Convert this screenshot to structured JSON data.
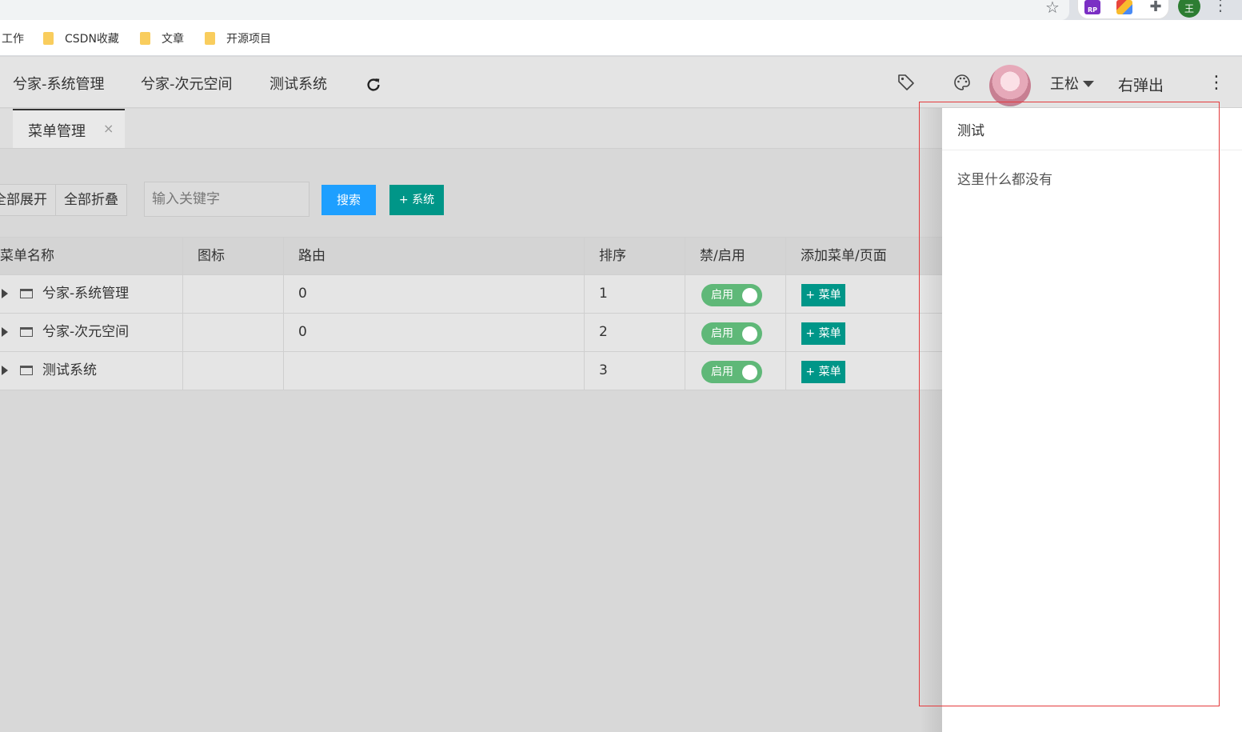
{
  "bookmarks": [
    {
      "label": "工作"
    },
    {
      "label": "CSDN收藏"
    },
    {
      "label": "文章"
    },
    {
      "label": "开源项目"
    }
  ],
  "browser": {
    "profile_initial": "王",
    "ext_rp_label": "RP"
  },
  "header": {
    "nav": [
      {
        "label": "兮家-系统管理"
      },
      {
        "label": "兮家-次元空间"
      },
      {
        "label": "测试系统"
      }
    ],
    "user_name": "王松",
    "right_popup_label": "右弹出"
  },
  "tabs": [
    {
      "label": "菜单管理",
      "close": "×"
    }
  ],
  "toolbar": {
    "expand_all": "全部展开",
    "collapse_all": "全部折叠",
    "search_placeholder": "输入关键字",
    "search_label": "搜索",
    "add_system_label": "+ 系统"
  },
  "table": {
    "columns": [
      "菜单名称",
      "图标",
      "路由",
      "排序",
      "禁/启用",
      "添加菜单/页面"
    ],
    "rows": [
      {
        "name": "兮家-系统管理",
        "icon": "",
        "route": "0",
        "order": "1",
        "status": "启用",
        "action": "+ 菜单"
      },
      {
        "name": "兮家-次元空间",
        "icon": "",
        "route": "0",
        "order": "2",
        "status": "启用",
        "action": "+ 菜单"
      },
      {
        "name": "测试系统",
        "icon": "",
        "route": "",
        "order": "3",
        "status": "启用",
        "action": "+ 菜单"
      }
    ]
  },
  "popup": {
    "title": "测试",
    "body": "这里什么都没有"
  },
  "colors": {
    "accent_blue": "#1e9fff",
    "accent_teal": "#009688",
    "switch_green": "#5fb878",
    "highlight_red": "#e4393c"
  }
}
